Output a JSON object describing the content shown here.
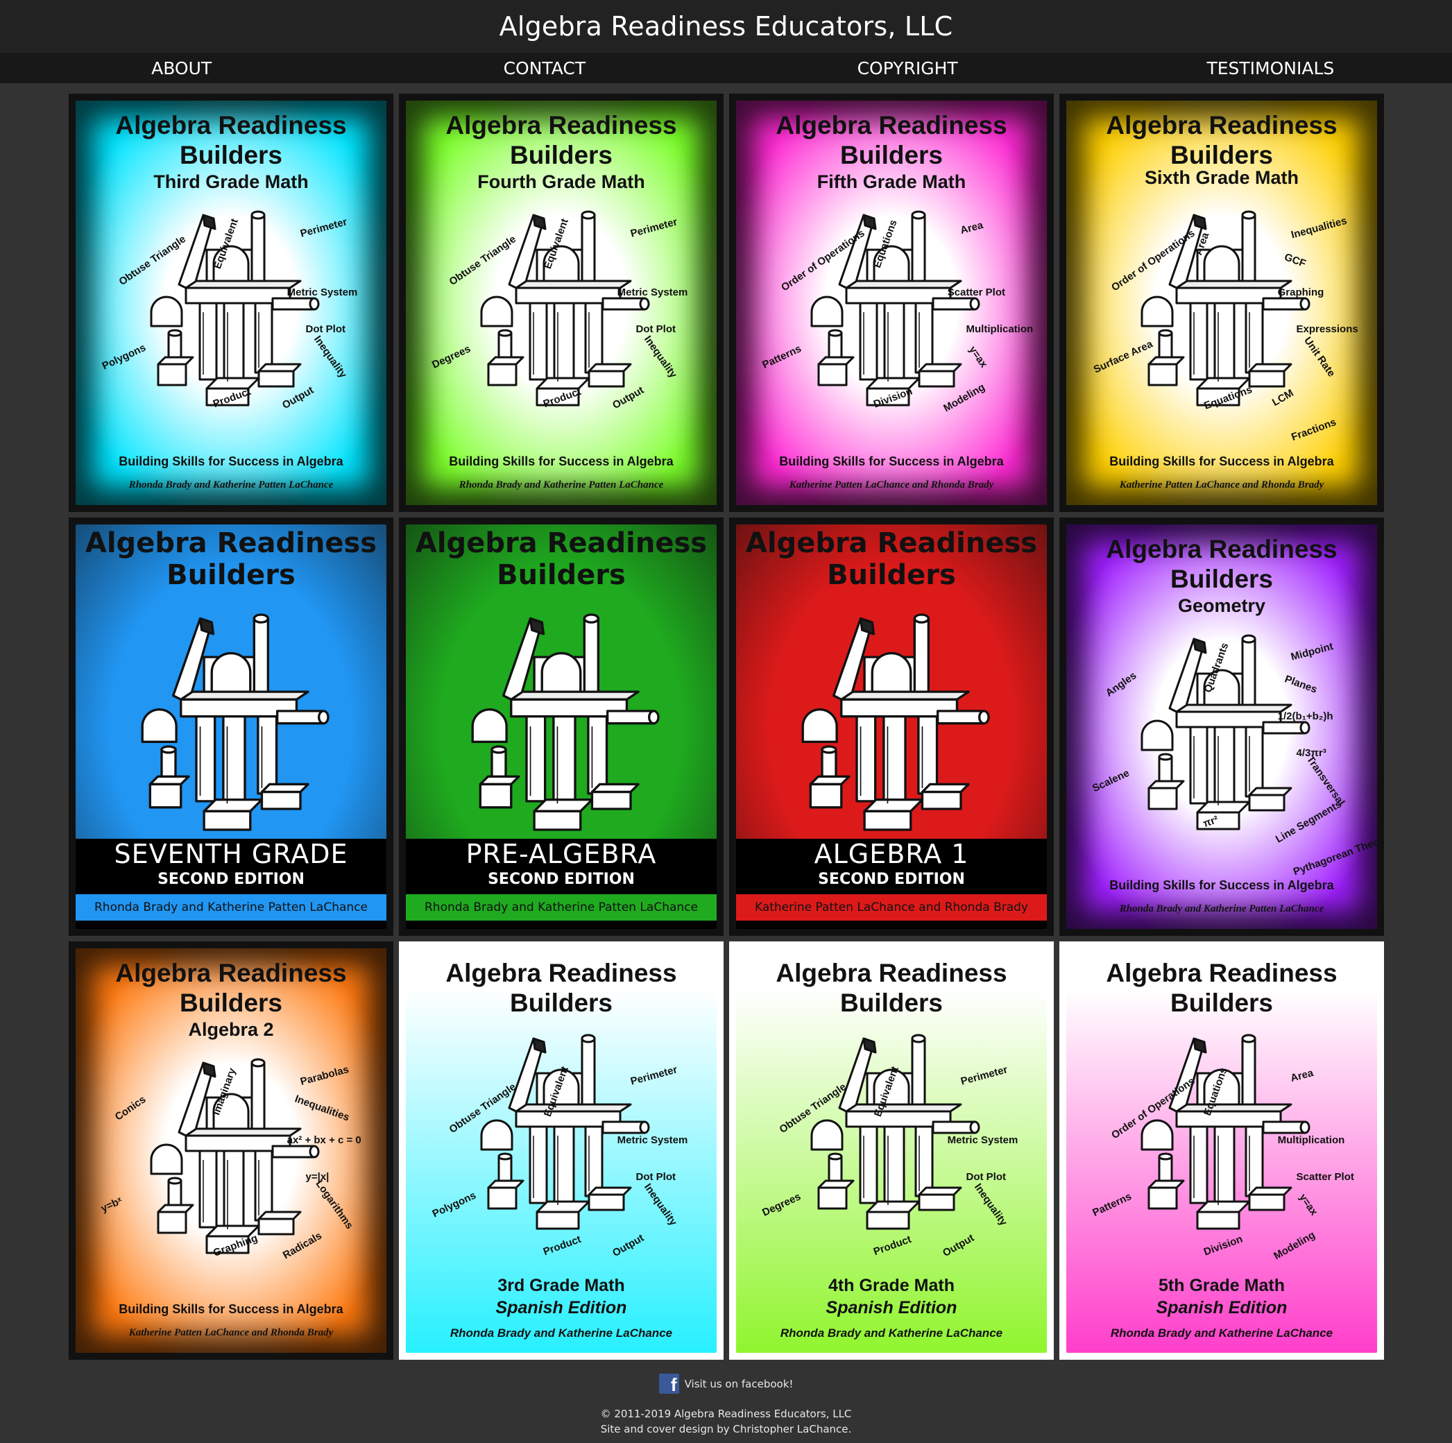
{
  "site": {
    "title": "Algebra Readiness Educators, LLC"
  },
  "nav": [
    {
      "label": "ABOUT"
    },
    {
      "label": "CONTACT"
    },
    {
      "label": "COPYRIGHT"
    },
    {
      "label": "TESTIMONIALS"
    }
  ],
  "book_title": "Algebra Readiness Builders",
  "tagline": "Building Skills for Success in Algebra",
  "covers": [
    {
      "subtitle": "Third Grade Math",
      "color": "#00e5ff",
      "authors": "Rhonda Brady and Katherine Patten LaChance",
      "terms": [
        "Obtuse Triangle",
        "Equivalent",
        "Perimeter",
        "Metric System",
        "Dot Plot",
        "Inequality",
        "Polygons",
        "Product",
        "Output"
      ]
    },
    {
      "subtitle": "Fourth Grade Math",
      "color": "#7cff2a",
      "authors": "Rhonda Brady and Katherine Patten LaChance",
      "terms": [
        "Obtuse Triangle",
        "Equivalent",
        "Perimeter",
        "Metric System",
        "Dot Plot",
        "Inequality",
        "Degrees",
        "Product",
        "Output"
      ]
    },
    {
      "subtitle": "Fifth Grade Math",
      "color": "#ff2ad4",
      "authors": "Katherine Patten LaChance and Rhonda Brady",
      "terms": [
        "Order of Operations",
        "Equations",
        "Area",
        "Scatter Plot",
        "Multiplication",
        "y=ax",
        "Patterns",
        "Division",
        "Modeling"
      ]
    },
    {
      "subtitle": "Sixth Grade Math",
      "color": "#ffd000",
      "authors": "Katherine Patten LaChance and Rhonda Brady",
      "terms": [
        "Order of Operations",
        "Area",
        "Inequalities",
        "Graphing",
        "Expressions",
        "Unit Rate",
        "Surface Area",
        "Equations",
        "LCM",
        "GCF",
        "Fractions"
      ]
    }
  ],
  "second_editions": [
    {
      "grade": "SEVENTH GRADE",
      "edition": "SECOND EDITION",
      "color": "#2196f3",
      "authors": "Rhonda Brady and Katherine Patten LaChance"
    },
    {
      "grade": "PRE-ALGEBRA",
      "edition": "SECOND EDITION",
      "color": "#1faa1f",
      "authors": "Rhonda Brady and Katherine Patten LaChance"
    },
    {
      "grade": "ALGEBRA 1",
      "edition": "SECOND EDITION",
      "color": "#dd1a1a",
      "authors": "Katherine Patten LaChance and Rhonda Brady"
    }
  ],
  "geometry": {
    "subtitle": "Geometry",
    "color": "#a020ff",
    "authors": "Rhonda Brady and Katherine Patten LaChance",
    "terms": [
      "Angles",
      "Quadrants",
      "Midpoint",
      "1/2(b₁+b₂)h",
      "4/3πr³",
      "Transversal",
      "Scalene",
      "πr²",
      "Line Segments",
      "Planes",
      "Pythagorean Theorem"
    ]
  },
  "algebra2": {
    "subtitle": "Algebra 2",
    "color": "#ff7a10",
    "authors": "Katherine Patten LaChance and Rhonda Brady",
    "terms": [
      "Conics",
      "Imaginary",
      "Parabolas",
      "ax² + bx + c = 0",
      "y=|x|",
      "Logarithms",
      "y=bˣ",
      "Graphing",
      "Radicals",
      "Inequalities"
    ]
  },
  "spanish": [
    {
      "grade": "3rd Grade Math",
      "edition": "Spanish Edition",
      "authors": "Rhonda Brady and Katherine LaChance",
      "color": "#27f0ff",
      "terms": [
        "Obtuse Triangle",
        "Equivalent",
        "Perimeter",
        "Metric System",
        "Dot Plot",
        "Inequality",
        "Polygons",
        "Product",
        "Output"
      ]
    },
    {
      "grade": "4th Grade Math",
      "edition": "Spanish Edition",
      "authors": "Rhonda Brady and Katherine LaChance",
      "color": "#90f52e",
      "terms": [
        "Obtuse Triangle",
        "Equivalent",
        "Perimeter",
        "Metric System",
        "Dot Plot",
        "Inequality",
        "Degrees",
        "Product",
        "Output"
      ]
    },
    {
      "grade": "5th Grade Math",
      "edition": "Spanish Edition",
      "authors": "Rhonda Brady and Katherine LaChance",
      "color": "#ff3ecb",
      "terms": [
        "Order of Operations",
        "Equations",
        "Area",
        "Multiplication",
        "Scatter Plot",
        "y=ax",
        "Patterns",
        "Division",
        "Modeling"
      ]
    }
  ],
  "footer": {
    "facebook_label": "Visit us on facebook!",
    "copyright": "© 2011-2019 Algebra Readiness Educators, LLC",
    "credit": "Site and cover design by Christopher LaChance."
  }
}
